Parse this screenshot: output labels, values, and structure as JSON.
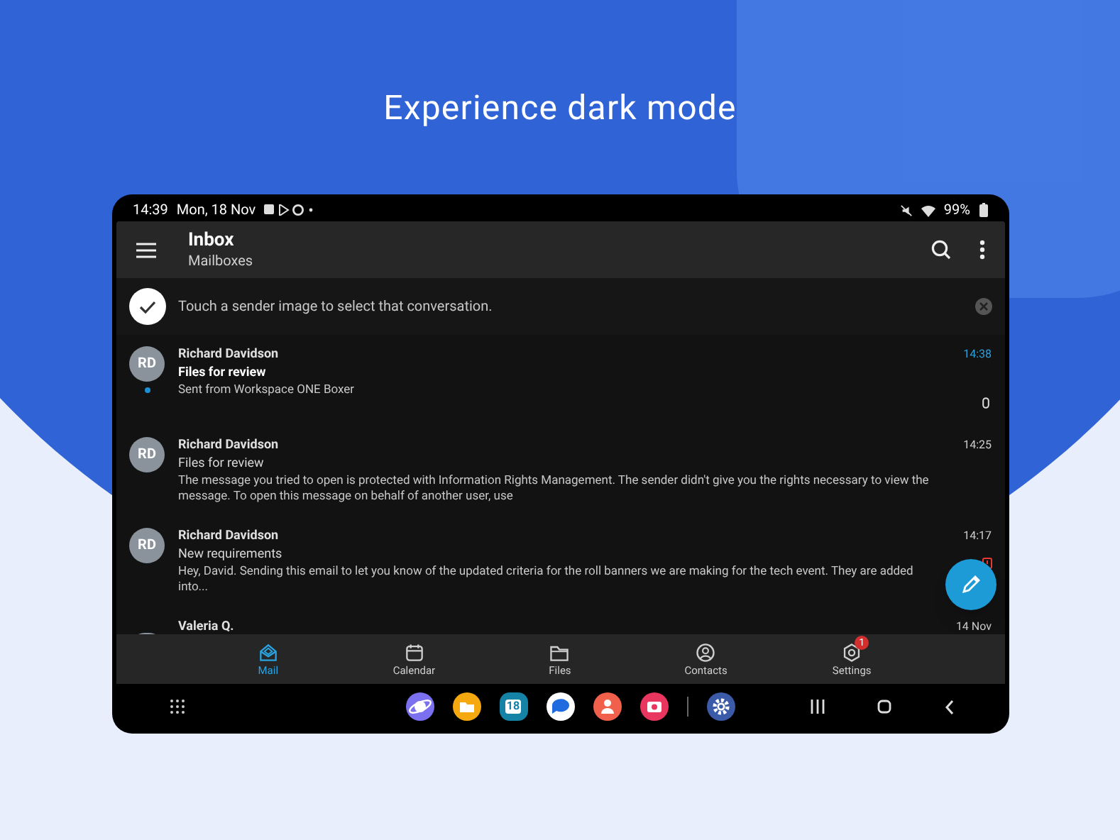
{
  "headline": "Experience dark mode",
  "status_bar": {
    "time": "14:39",
    "date": "Mon, 18 Nov",
    "battery": "99%"
  },
  "app_bar": {
    "title": "Inbox",
    "subtitle": "Mailboxes"
  },
  "tip": {
    "text": "Touch a sender image to select that conversation."
  },
  "messages": [
    {
      "initials": "RD",
      "sender": "Richard Davidson",
      "subject": "Files for review",
      "preview": "Sent from Workspace ONE Boxer",
      "time": "14:38",
      "unread": true,
      "attachment": true,
      "important": false
    },
    {
      "initials": "RD",
      "sender": "Richard Davidson",
      "subject": "Files for review",
      "preview": "The message you tried to open is protected with Information Rights Management. The sender didn't give you the rights necessary to view the message. To open this message on behalf of another user, use",
      "time": "14:25",
      "unread": false,
      "attachment": false,
      "important": false
    },
    {
      "initials": "RD",
      "sender": "Richard Davidson",
      "subject": "New requirements",
      "preview": "Hey, David. Sending this email to let you know of the updated criteria for the roll banners we are making for the tech event. They are added into...",
      "time": "14:17",
      "unread": false,
      "attachment": false,
      "important": true
    },
    {
      "sender": "Valeria Q.",
      "time": "14 Nov",
      "unread": false,
      "attachment": false,
      "important": false
    }
  ],
  "bottom_nav": [
    {
      "kind": "mail",
      "label": "Mail",
      "selected": true
    },
    {
      "kind": "calendar",
      "label": "Calendar",
      "selected": false
    },
    {
      "kind": "files",
      "label": "Files",
      "selected": false
    },
    {
      "kind": "contacts",
      "label": "Contacts",
      "selected": false
    },
    {
      "kind": "settings",
      "label": "Settings",
      "selected": false,
      "badge": "1"
    }
  ],
  "taskbar": {
    "calendar_date": "18"
  }
}
